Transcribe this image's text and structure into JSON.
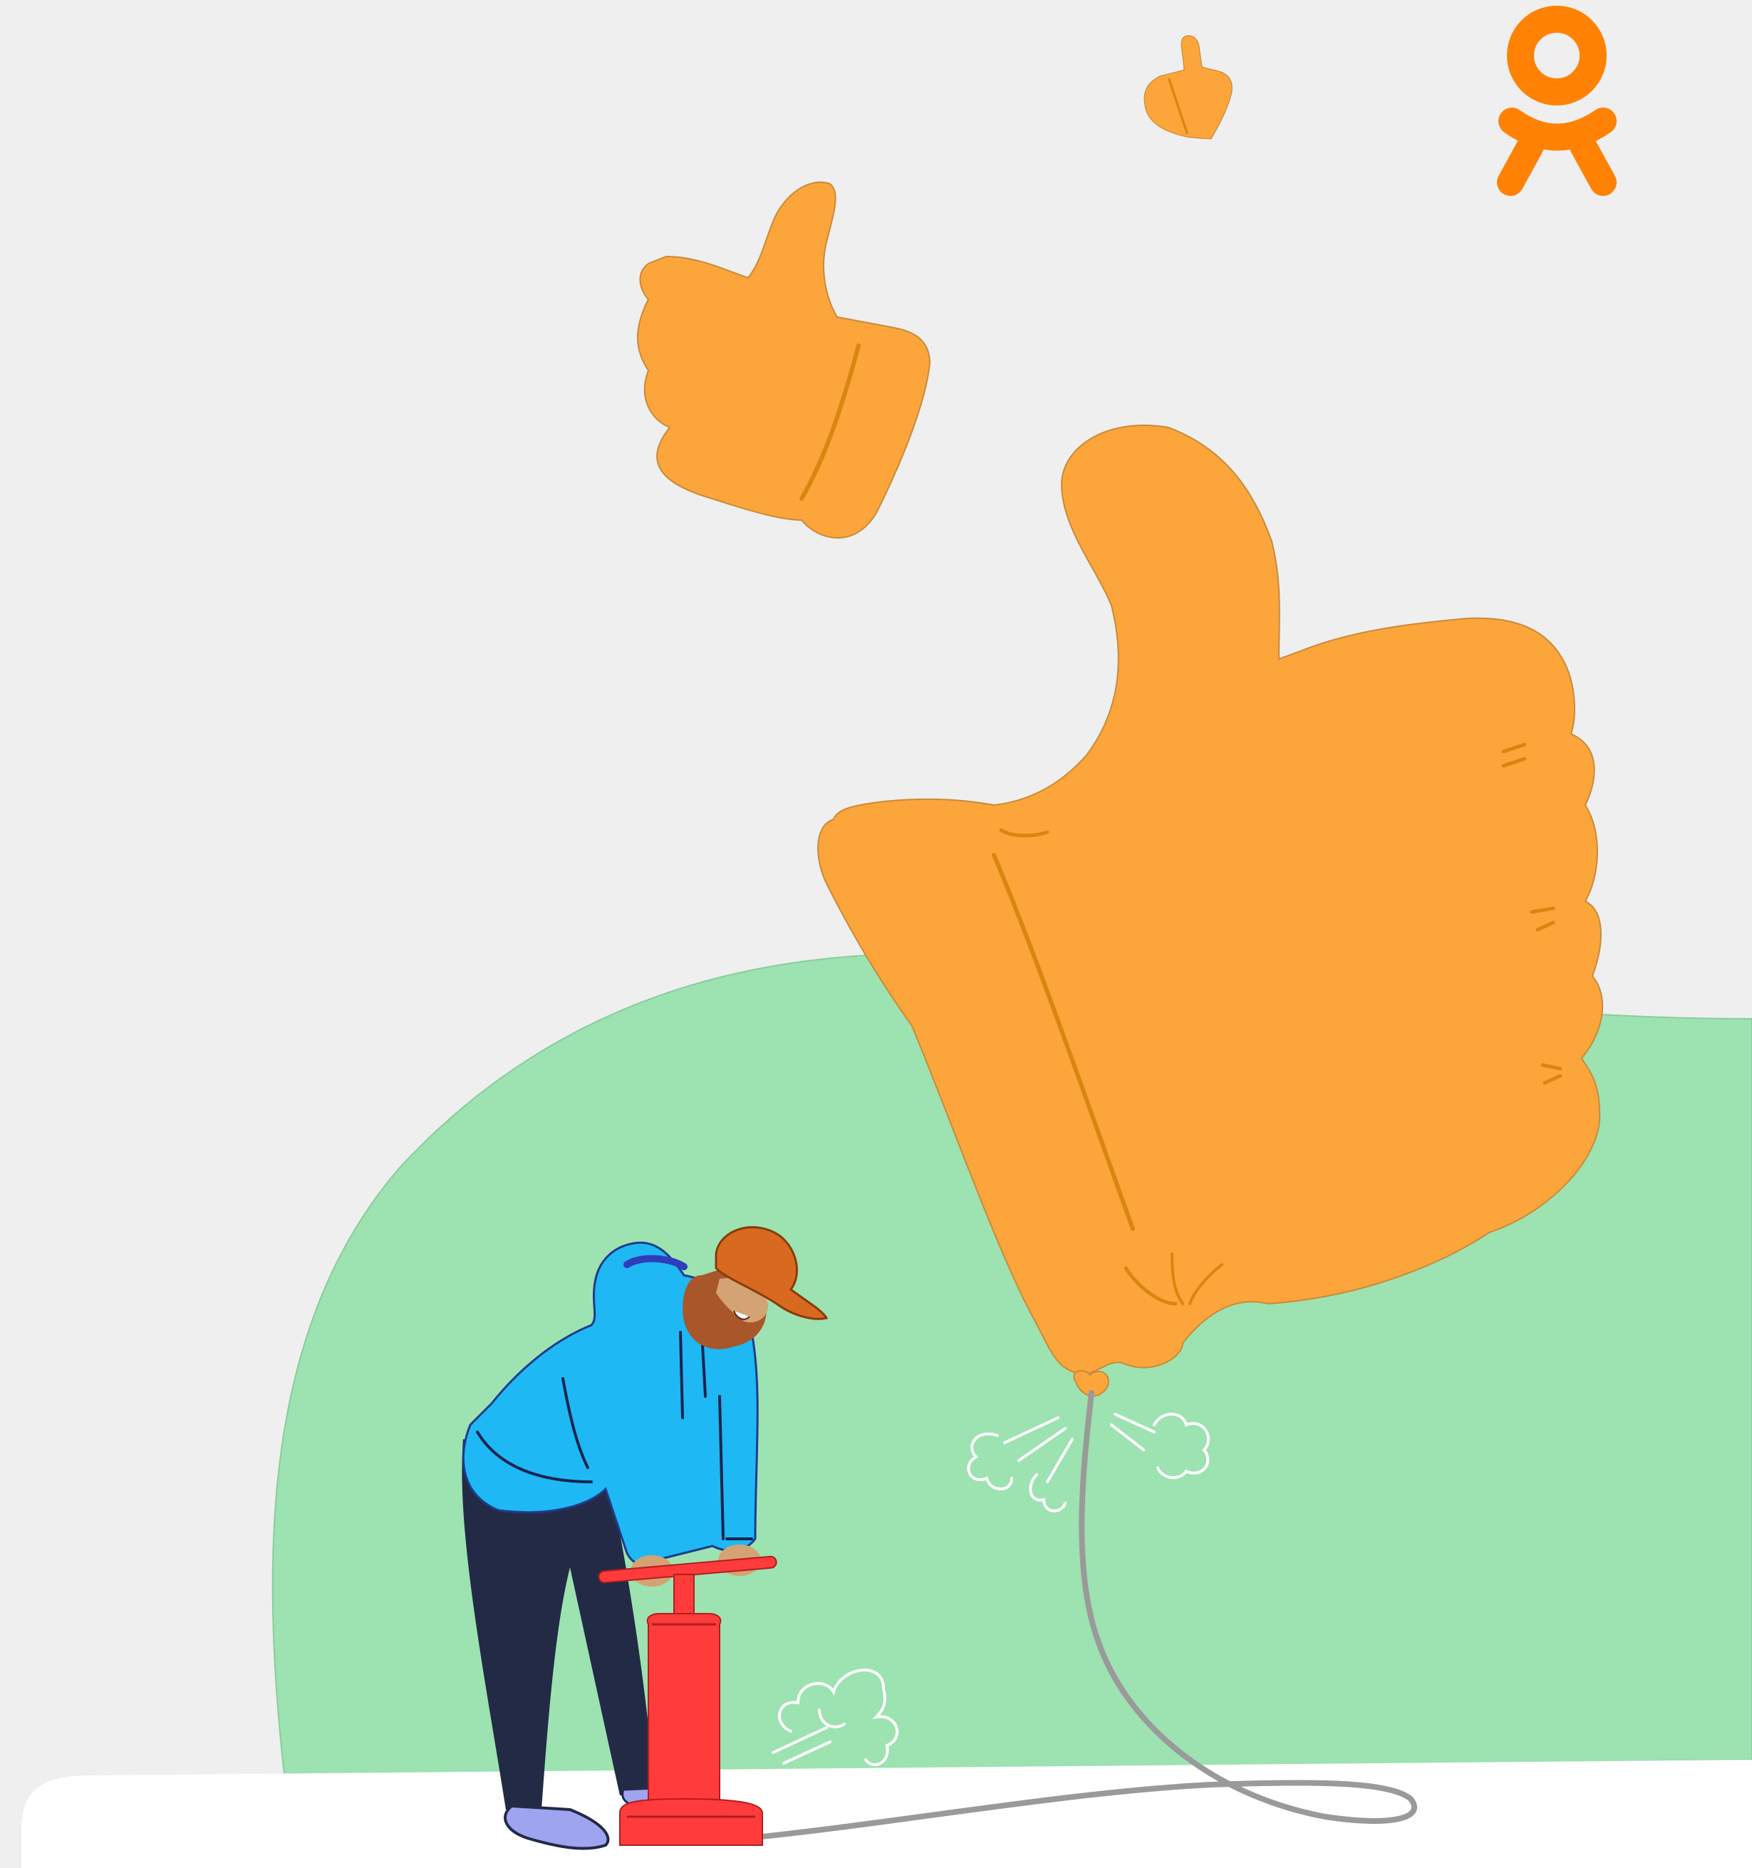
{
  "illustration": {
    "logo": {
      "icon": "ok-logo-icon",
      "color": "#ff8205"
    },
    "palette": {
      "background": "#efefef",
      "hill": "#9de2b1",
      "balloon": "#fca53b",
      "balloon_line": "#d9860f",
      "jacket": "#1eb8f5",
      "pants": "#222a45",
      "cap": "#d86a1f",
      "pump": "#ff3b3b",
      "shoes": "#9fa4f0",
      "hose": "#9a9a9a"
    },
    "icons": [
      "thumbs-up-icon",
      "thumbs-up-icon",
      "thumbs-up-balloon-icon",
      "air-puff-icon",
      "air-pump-icon"
    ]
  }
}
